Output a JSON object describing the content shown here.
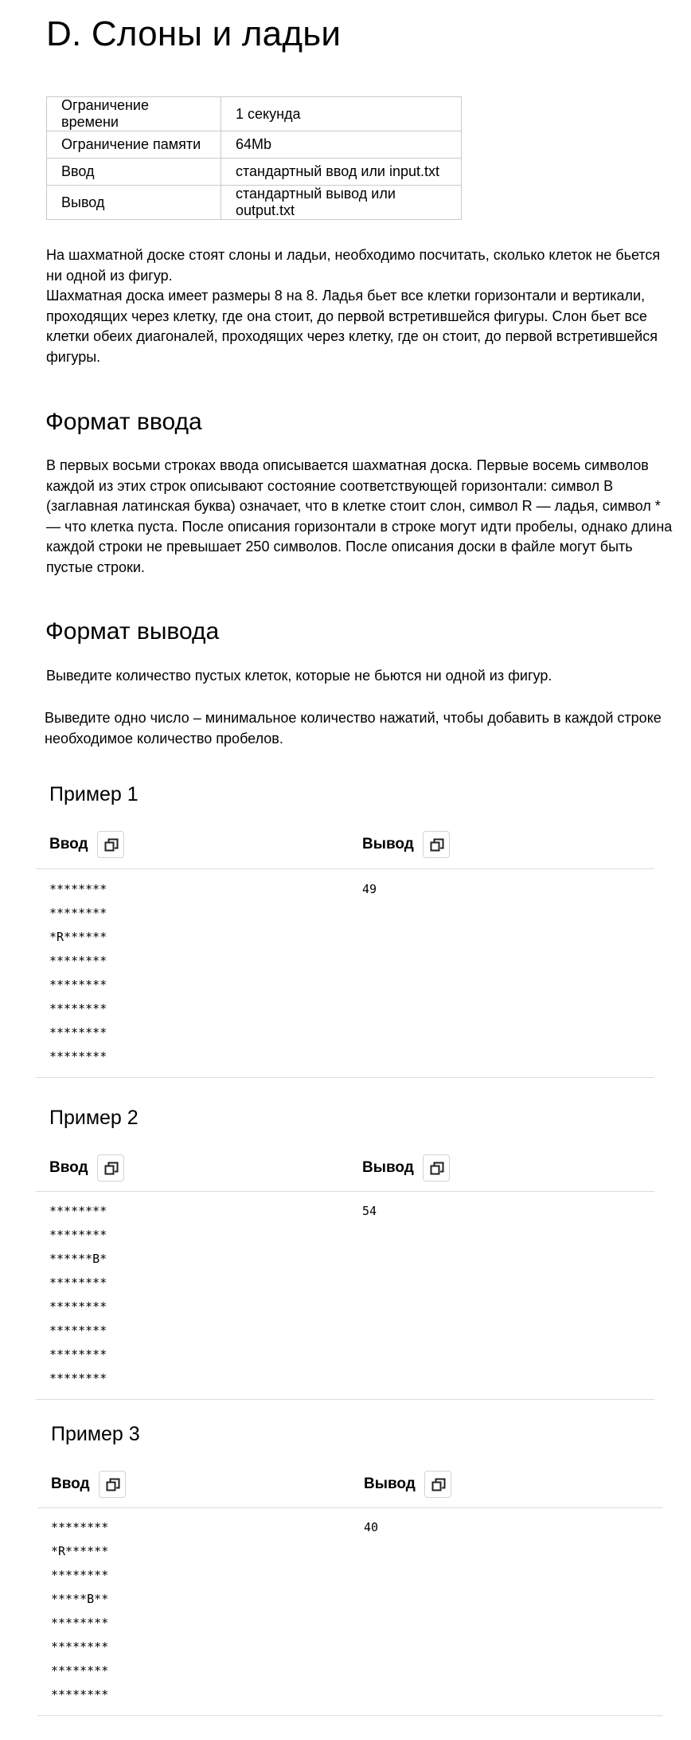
{
  "problem": {
    "title": "D. Слоны и ладьи",
    "limits": [
      {
        "label": "Ограничение времени",
        "value": "1 секунда"
      },
      {
        "label": "Ограничение памяти",
        "value": "64Mb"
      },
      {
        "label": "Ввод",
        "value": "стандартный ввод или input.txt"
      },
      {
        "label": "Вывод",
        "value": "стандартный вывод или output.txt"
      }
    ],
    "statement": [
      "На шахматной доске стоят слоны и ладьи, необходимо посчитать, сколько клеток не бьется ни одной из фигур.",
      "Шахматная доска имеет размеры 8 на 8. Ладья бьет все клетки горизонтали и вертикали, проходящих через клетку, где она стоит, до первой встретившейся фигуры. Слон бьет все клетки обеих диагоналей, проходящих через клетку, где он стоит, до первой встретившейся фигуры."
    ],
    "input_format": {
      "heading": "Формат ввода",
      "text": "В первых восьми строках ввода описывается шахматная доска. Первые восемь символов каждой из этих строк описывают состояние соответствующей горизонтали: символ B (заглавная латинская буква) означает, что в клетке стоит слон, символ R — ладья, символ * — что клетка пуста. После описания горизонтали в строке могут идти пробелы, однако длина каждой строки не превышает 250 символов. После описания доски в файле могут быть пустые строки."
    },
    "output_format": {
      "heading": "Формат вывода",
      "text1": "Выведите количество пустых клеток, которые не бьются ни одной из фигур.",
      "text2": "Выведите одно число – минимальное количество нажатий, чтобы добавить в каждой строке необходимое количество пробелов."
    },
    "examples": [
      {
        "title": "Пример 1",
        "input_label": "Ввод",
        "output_label": "Вывод",
        "input": "********\n********\n*R******\n********\n********\n********\n********\n********",
        "output": "49"
      },
      {
        "title": "Пример 2",
        "input_label": "Ввод",
        "output_label": "Вывод",
        "input": "********\n********\n******B*\n********\n********\n********\n********\n********",
        "output": "54"
      },
      {
        "title": "Пример 3",
        "input_label": "Ввод",
        "output_label": "Вывод",
        "input": "********\n*R******\n********\n*****B**\n********\n********\n********\n********",
        "output": "40"
      }
    ],
    "icons": {
      "copy": "copy-icon"
    }
  }
}
